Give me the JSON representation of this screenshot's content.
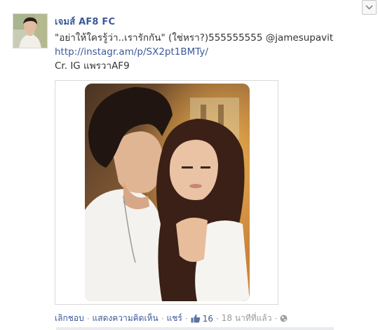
{
  "post": {
    "author": "เจมส์ AF8 FC",
    "text_line1": "\"อย่าให้ใครรู้ว่า..เรารักกัน\" (ใช่หรา?)555555555 @jamesupavit",
    "link": "http://instagr.am/p/SX2pt1BMTy/",
    "credit": "Cr. IG แพรวาAF9"
  },
  "actions": {
    "unlike": "เลิกชอบ",
    "comment": "แสดงความคิดเห็น",
    "share": "แชร์",
    "like_count": "16",
    "timestamp": "18 นาทีที่แล้ว",
    "separator": "·"
  },
  "icons": {
    "options": "chevron-down-icon",
    "like": "thumbs-up-icon",
    "privacy": "globe-icon"
  },
  "colors": {
    "link_blue": "#3b5998",
    "text_gray": "#999999"
  }
}
